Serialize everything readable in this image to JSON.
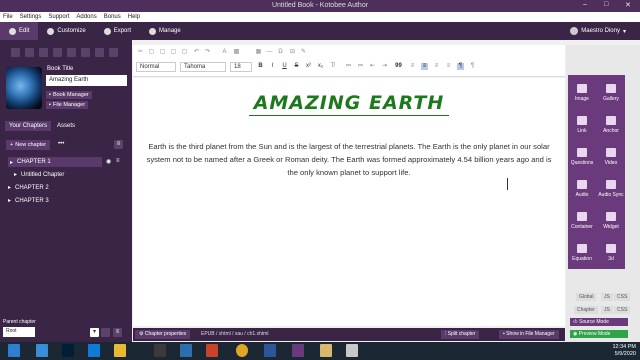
{
  "window": {
    "title": "Untitled Book - Kotobee Author",
    "minimize": "–",
    "maximize": "□",
    "close": "✕"
  },
  "menu": [
    "File",
    "Settings",
    "Support",
    "Addons",
    "Bonus",
    "Help"
  ],
  "modes": [
    {
      "label": "Edit",
      "icon": "pencil-icon"
    },
    {
      "label": "Customize",
      "icon": "palette-icon"
    },
    {
      "label": "Export",
      "icon": "export-icon"
    },
    {
      "label": "Manage",
      "icon": "manage-icon"
    }
  ],
  "user": {
    "name": "Maestro Diony",
    "caret": "▾"
  },
  "sidebar": {
    "book_title_label": "Book Title",
    "book_title_value": "Amazing Earth",
    "book_manager": "Book Manager",
    "file_manager": "File Manager",
    "tabs": [
      "Your Chapters",
      "Assets"
    ],
    "new_chapter": "New chapter",
    "more": "•••",
    "chapters": [
      "CHAPTER 1",
      "Untitled Chapter",
      "CHAPTER 2",
      "CHAPTER 3"
    ],
    "parent_chapter_label": "Parent chapter",
    "parent_chapter_value": "Root"
  },
  "toolbar": {
    "style_select": "Normal",
    "font_select": "Tahoma",
    "size_select": "18",
    "format": [
      "B",
      "I",
      "U",
      "S",
      "x²",
      "x₂"
    ],
    "quote": "99"
  },
  "document": {
    "title": "AMAZING EARTH",
    "body": "Earth is the third planet from the Sun and is the largest of the terrestrial planets. The Earth is the only planet in our solar system not to be named after a Greek or Roman deity. The Earth was formed approximately 4.54 billion years ago and is the only known planet to support life."
  },
  "widgets": [
    {
      "label": "Image",
      "icon": "image-icon"
    },
    {
      "label": "Gallery",
      "icon": "gallery-icon"
    },
    {
      "label": "Link",
      "icon": "link-icon"
    },
    {
      "label": "Anchor",
      "icon": "anchor-icon"
    },
    {
      "label": "Questions",
      "icon": "questions-icon"
    },
    {
      "label": "Video",
      "icon": "video-icon"
    },
    {
      "label": "Audio",
      "icon": "audio-icon"
    },
    {
      "label": "Audio Sync",
      "icon": "audio-sync-icon"
    },
    {
      "label": "Container",
      "icon": "container-icon"
    },
    {
      "label": "Widget",
      "icon": "widget-icon"
    },
    {
      "label": "Equation",
      "icon": "equation-icon"
    },
    {
      "label": "3d",
      "icon": "cube-icon"
    }
  ],
  "right_panel": {
    "global": "Global",
    "chapter": "Chapter",
    "js": "JS",
    "css": "CSS",
    "source_mode": "Source Mode",
    "preview_mode": "Preview Mode"
  },
  "bottombar": {
    "chapter_properties": "Chapter properties",
    "path": "EPUB / xhtml / xau / ch1.xhtml",
    "split_chapter": "Split chapter",
    "show_in_file_manager": "Show in File Manager"
  },
  "taskbar": {
    "time": "12:34 PM",
    "date": "5/9/2020"
  },
  "colors": {
    "brand_dark": "#3a2546",
    "brand": "#5a3a6b",
    "widget_panel": "#6b3a7c",
    "title_green": "#1c7a1c"
  }
}
